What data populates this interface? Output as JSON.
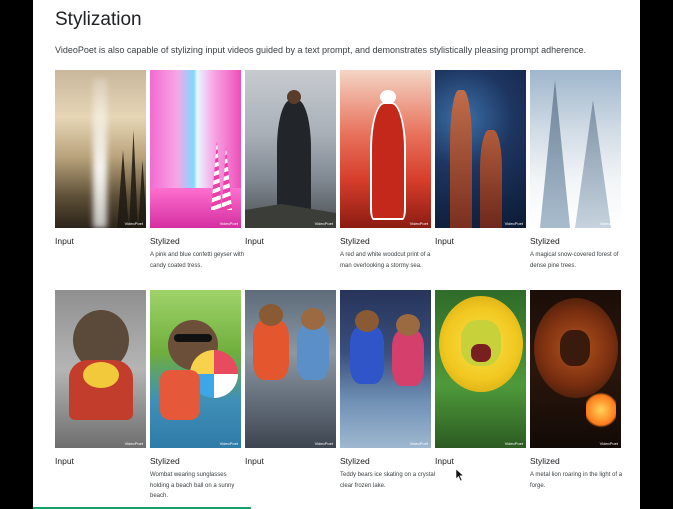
{
  "section": {
    "title": "Stylization",
    "description": "VideoPoet is also capable of stylizing input videos guided by a text prompt, and demonstrates stylistically pleasing prompt adherence."
  },
  "watermark": "VideoPoet",
  "rows": [
    {
      "cells": [
        {
          "label": "Input",
          "caption": ""
        },
        {
          "label": "Stylized",
          "caption": "A pink and blue confetti geyser with candy coated tress."
        },
        {
          "label": "Input",
          "caption": ""
        },
        {
          "label": "Stylized",
          "caption": "A red and white woodcut print of a man overlooking a stormy sea."
        },
        {
          "label": "Input",
          "caption": ""
        },
        {
          "label": "Stylized",
          "caption": "A magical snow-covered forest of dense pine trees."
        }
      ]
    },
    {
      "cells": [
        {
          "label": "Input",
          "caption": ""
        },
        {
          "label": "Stylized",
          "caption": "Wombat wearing sunglasses holding a beach ball on a sunny beach."
        },
        {
          "label": "Input",
          "caption": ""
        },
        {
          "label": "Stylized",
          "caption": "Teddy bears ice skating on a crystal clear frozen lake."
        },
        {
          "label": "Input",
          "caption": ""
        },
        {
          "label": "Stylized",
          "caption": "A metal lion roaring in the light of a forge."
        }
      ]
    }
  ]
}
